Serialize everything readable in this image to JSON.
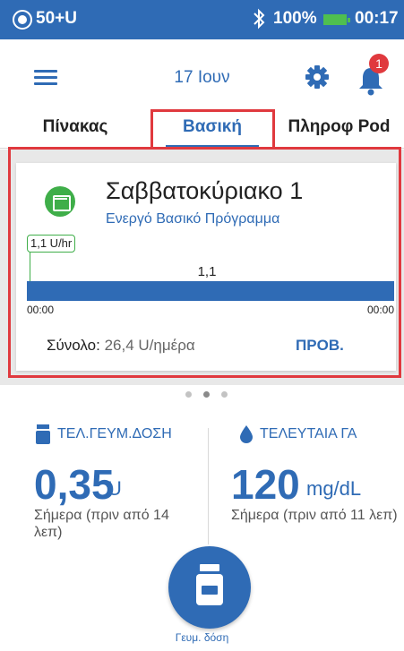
{
  "status_bar": {
    "pod_status": "50+U",
    "battery_percent": "100%",
    "time": "00:17",
    "icons": [
      "pod-icon",
      "bluetooth-icon",
      "battery-icon"
    ]
  },
  "header": {
    "date": "17 Ιουν",
    "notification_count": "1",
    "icons": [
      "menu-icon",
      "gear-icon",
      "bell-icon"
    ]
  },
  "tabs": [
    {
      "label": "Πίνακας"
    },
    {
      "label": "Βασική"
    },
    {
      "label": "Πληροφ Pod"
    }
  ],
  "basal_card": {
    "program_name": "Σαββατοκύριακο 1",
    "status": "Ενεργό Βασικό Πρόγραμμα",
    "current_rate": "1,1 U/hr",
    "bar_value": "1,1",
    "time_start": "00:00",
    "time_end": "00:00",
    "total_label": "Σύνολο:",
    "total_value": "26,4 U/ημέρα",
    "view_label": "ΠΡΟΒ."
  },
  "pager": {
    "pages": 3,
    "active_page": 2
  },
  "last_bolus": {
    "title": "ΤΕΛ.ΓΕΥΜ.ΔΟΣΗ",
    "value": "0,35",
    "unit": "U",
    "time": "Σήμερα (πριν από 14 λεπ)"
  },
  "last_bg": {
    "title": "ΤΕΛΕΥΤΑΙΑ ΓΑ",
    "value": "120",
    "unit": "mg/dL",
    "time": "Σήμερα (πριν από 11 λεπ)"
  },
  "bolus_button": {
    "label": "Γευμ. δόση"
  },
  "colors": {
    "brand_blue": "#2f6bb5",
    "highlight_red": "#e0393e",
    "program_green": "#3fae49",
    "battery_green": "#4fbf4f"
  }
}
